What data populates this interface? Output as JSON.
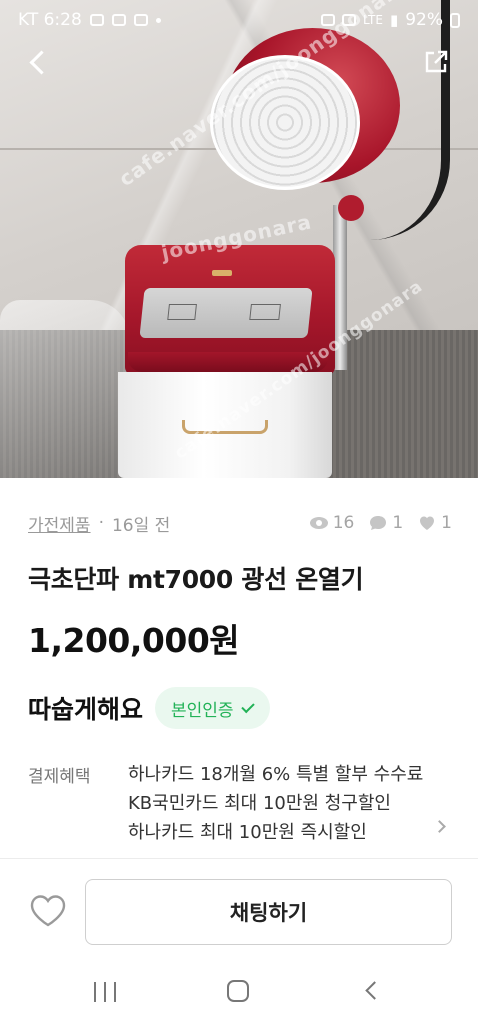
{
  "status_bar": {
    "carrier_time": "KT 6:28",
    "network": "LTE",
    "battery": "92%"
  },
  "photo": {
    "watermarks": [
      "cafe.naver.com/joonggonara",
      "joonggonara",
      "cafe.naver.com/joonggonara"
    ]
  },
  "meta": {
    "category": "가전제품",
    "separator": "·",
    "posted": "16일 전",
    "views": "16",
    "chats": "1",
    "likes": "1"
  },
  "product": {
    "title": "극초단파 mt7000 광선 온열기",
    "price": "1,200,000원"
  },
  "seller": {
    "name": "따숩게해요",
    "badge": "본인인증"
  },
  "payment_benefit": {
    "label": "결제혜택",
    "items": [
      "하나카드 18개월 6% 특별 할부 수수료",
      "KB국민카드 최대 10만원 청구할인",
      "하나카드 최대 10만원 즉시할인"
    ]
  },
  "actions": {
    "chat_label": "채팅하기"
  },
  "icons": {
    "back": "back-arrow-icon",
    "share": "share-icon",
    "views": "eye-icon",
    "chats": "chat-bubble-icon",
    "likes": "heart-icon",
    "verified": "check-icon"
  },
  "colors": {
    "verified_green": "#22b257",
    "verified_bg": "#eaf8ef",
    "meta_gray": "#9a9a9a"
  }
}
